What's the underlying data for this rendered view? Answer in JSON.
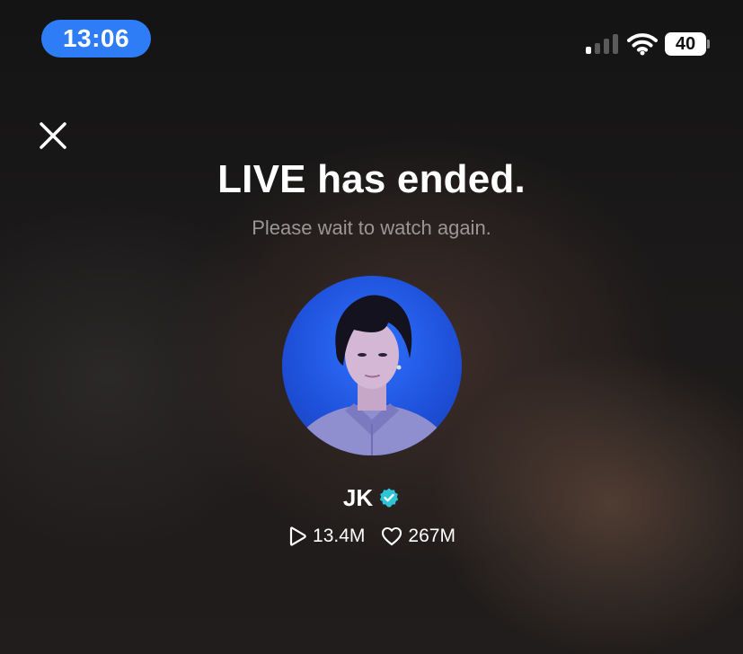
{
  "status_bar": {
    "time": "13:06",
    "battery_level": "40",
    "icons": [
      "signal-icon",
      "wifi-icon",
      "battery-icon"
    ]
  },
  "header": {
    "close_icon": "close-icon"
  },
  "live": {
    "title": "LIVE has ended.",
    "subtitle": "Please wait to watch again."
  },
  "creator": {
    "name": "JK",
    "verified_icon": "verified-badge-icon",
    "views": "13.4M",
    "likes": "267M"
  },
  "colors": {
    "accent": "#2f7df6",
    "verified": "#2ec4d6",
    "text_secondary": "#9a9696"
  }
}
